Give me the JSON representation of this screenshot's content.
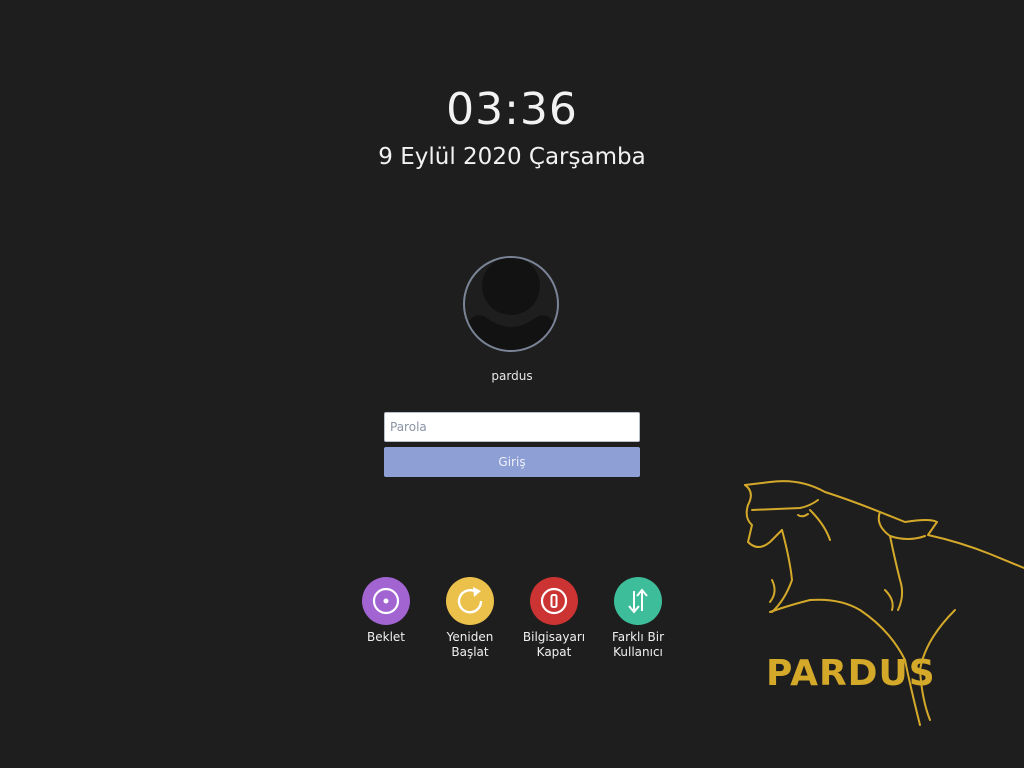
{
  "clock": {
    "time": "03:36",
    "date": "9 Eylül 2020 Çarşamba"
  },
  "user": {
    "name": "pardus",
    "avatar_icon": "user-silhouette-icon"
  },
  "login": {
    "password_placeholder": "Parola",
    "password_value": "",
    "submit_label": "Giriş"
  },
  "actions": [
    {
      "label": "Beklet",
      "icon": "suspend-icon",
      "color": "#a264d1"
    },
    {
      "label": "Yeniden\nBaşlat",
      "icon": "restart-icon",
      "color": "#ebc04b"
    },
    {
      "label": "Bilgisayarı\nKapat",
      "icon": "power-icon",
      "color": "#cc3333"
    },
    {
      "label": "Farklı Bir\nKullanıcı",
      "icon": "switch-user-icon",
      "color": "#3dbd9a"
    }
  ],
  "branding": {
    "logo_text": "PARDUS",
    "logo_color": "#d4a92a"
  }
}
